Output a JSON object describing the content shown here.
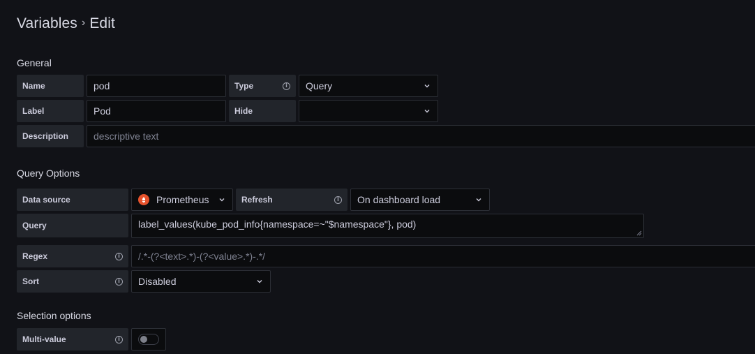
{
  "header": {
    "breadcrumb_root": "Variables",
    "separator": "›",
    "current": "Edit"
  },
  "general": {
    "title": "General",
    "name_label": "Name",
    "name_value": "pod",
    "type_label": "Type",
    "type_value": "Query",
    "label_label": "Label",
    "label_value": "Pod",
    "hide_label": "Hide",
    "hide_value": "",
    "description_label": "Description",
    "description_placeholder": "descriptive text"
  },
  "query_options": {
    "title": "Query Options",
    "datasource_label": "Data source",
    "datasource_value": "Prometheus",
    "refresh_label": "Refresh",
    "refresh_value": "On dashboard load",
    "query_label": "Query",
    "query_value": "label_values(kube_pod_info{namespace=~\"$namespace\"}, pod)",
    "regex_label": "Regex",
    "regex_placeholder": "/.*-(?<text>.*)-(?<value>.*)-.*/",
    "sort_label": "Sort",
    "sort_value": "Disabled"
  },
  "selection_options": {
    "title": "Selection options",
    "multivalue_label": "Multi-value",
    "multivalue_enabled": false
  },
  "icons": {
    "info": "info-circle-icon",
    "chevron": "chevron-down-icon",
    "datasource": "prometheus-logo-icon"
  },
  "colors": {
    "background": "#111217",
    "label_bg": "#22252b",
    "input_bg": "#0b0c0e",
    "prometheus": "#e6522c"
  }
}
